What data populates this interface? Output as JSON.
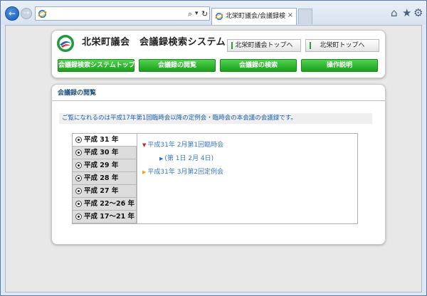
{
  "browser": {
    "tab_title": "北栄町議会/会議録検索シ...",
    "tab_close": "×",
    "address_value": "",
    "search_glyph": "⌕",
    "dropdown_glyph": "▾",
    "refresh_glyph": "↻",
    "home_glyph": "⌂",
    "favorites_glyph": "★",
    "settings_glyph": "⚙",
    "back_glyph": "←",
    "forward_glyph": "→"
  },
  "header": {
    "site_title": "北栄町議会　会議録検索システム",
    "top_links": [
      {
        "label": "北栄町議会トップへ"
      },
      {
        "label": "北栄町トップへ"
      }
    ],
    "nav": [
      {
        "label": "会議録検索システムトップ"
      },
      {
        "label": "会議録の閲覧"
      },
      {
        "label": "会議録の検索"
      },
      {
        "label": "操作説明"
      }
    ]
  },
  "content": {
    "section_title": "会議録の閲覧",
    "notice": "ご覧になれるのは平成17年第1回臨時会以降の定例会・臨時会の本会議の会議録です。",
    "years": [
      {
        "label": "平成 31 年",
        "active": true
      },
      {
        "label": "平成 30 年",
        "active": false
      },
      {
        "label": "平成 29 年",
        "active": false
      },
      {
        "label": "平成 28 年",
        "active": false
      },
      {
        "label": "平成 27 年",
        "active": false
      },
      {
        "label": "平成 22～26 年",
        "active": false
      },
      {
        "label": "平成 17～21 年",
        "active": false
      }
    ],
    "sessions": [
      {
        "label": "平成31年 2月第1回臨時会",
        "expanded": true
      },
      {
        "label": "(第 1日 2月 4日)",
        "sub": true
      },
      {
        "label": "平成31年 3月第2回定例会",
        "expanded": false
      }
    ]
  },
  "colors": {
    "nav_green": "#1d9e1d",
    "link_blue": "#3a78c8",
    "section_title": "#1e4f7a",
    "notice_blue": "#1a5fb4",
    "expanded_arrow": "#d32020",
    "collapsed_arrow": "#f0a020"
  }
}
